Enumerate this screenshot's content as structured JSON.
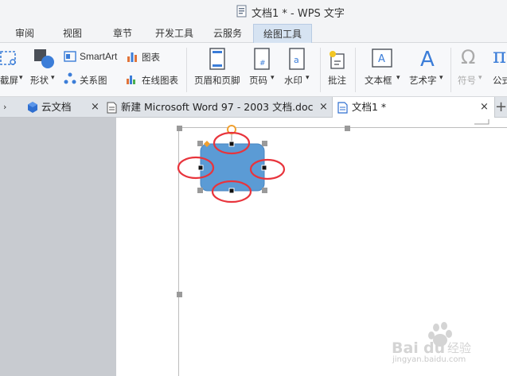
{
  "window": {
    "title": "文档1 * - WPS 文字"
  },
  "ribbon_tabs": [
    "审阅",
    "视图",
    "章节",
    "开发工具",
    "云服务",
    "绘图工具"
  ],
  "active_ribbon_tab": "绘图工具",
  "ribbon": {
    "screenshot": "截屏",
    "shapes": "形状",
    "smartart": "SmartArt",
    "chart": "图表",
    "relation_chart": "关系图",
    "online_chart": "在线图表",
    "header_footer": "页眉和页脚",
    "page_number": "页码",
    "watermark": "水印",
    "comment": "批注",
    "textbox": "文本框",
    "wordart": "艺术字",
    "symbol": "符号",
    "formula": "公式"
  },
  "doc_tabs": {
    "cloud_docs": "云文档",
    "word_doc": "新建 Microsoft Word 97 - 2003 文档.doc",
    "doc1": "文档1 *",
    "close_glyph": "×",
    "add_glyph": "+"
  },
  "colors": {
    "shape_fill": "#5b9bd5",
    "annotation_ring": "#e8343c",
    "rotate_handle": "#f0a030"
  },
  "watermark": {
    "brand": "Baidu经验",
    "url": "jingyan.baidu.com"
  }
}
